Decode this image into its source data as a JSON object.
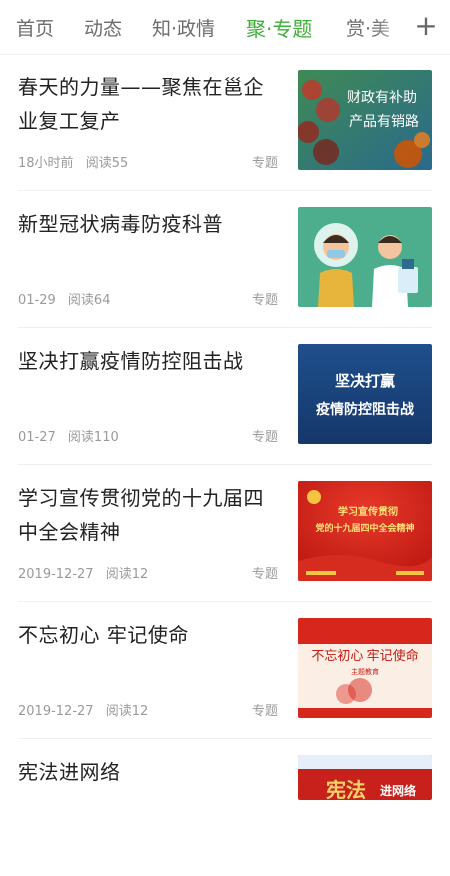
{
  "tabs": [
    {
      "label": "首页",
      "active": false
    },
    {
      "label": "动态",
      "active": false
    },
    {
      "label": "知·政情",
      "active": false
    },
    {
      "label": "聚·专题",
      "active": true
    },
    {
      "label": "赏·美",
      "active": false
    }
  ],
  "add_tab_label": "+",
  "accent_color": "#3fae3a",
  "articles": [
    {
      "title": "春天的力量——聚焦在邕企业复工复产",
      "time": "18小时前",
      "reads": "阅读55",
      "tag": "专题",
      "thumb": {
        "lines": [
          "财政有补助",
          "产品有销路"
        ],
        "icon": "fruit-farm-image"
      }
    },
    {
      "title": "新型冠状病毒防疫科普",
      "time": "01-29",
      "reads": "阅读64",
      "tag": "专题",
      "thumb": {
        "lines": [],
        "icon": "masked-people-illustration"
      }
    },
    {
      "title": "坚决打赢疫情防控阻击战",
      "time": "01-27",
      "reads": "阅读110",
      "tag": "专题",
      "thumb": {
        "lines": [
          "坚决打赢",
          "疫情防控阻击战"
        ],
        "icon": "banner-image"
      }
    },
    {
      "title": "学习宣传贯彻党的十九届四中全会精神",
      "time": "2019-12-27",
      "reads": "阅读12",
      "tag": "专题",
      "thumb": {
        "lines": [
          "学习宣传贯彻",
          "党的十九届四中全会精神"
        ],
        "icon": "party-banner-image"
      }
    },
    {
      "title": "不忘初心 牢记使命",
      "time": "2019-12-27",
      "reads": "阅读12",
      "tag": "专题",
      "thumb": {
        "lines": [
          "不忘初心 牢记使命",
          "主题教育"
        ],
        "icon": "party-banner-image"
      }
    },
    {
      "title": "宪法进网络",
      "time": "",
      "reads": "",
      "tag": "",
      "thumb": {
        "lines": [
          "宪法",
          "进网络"
        ],
        "icon": "constitution-banner-image"
      }
    }
  ]
}
